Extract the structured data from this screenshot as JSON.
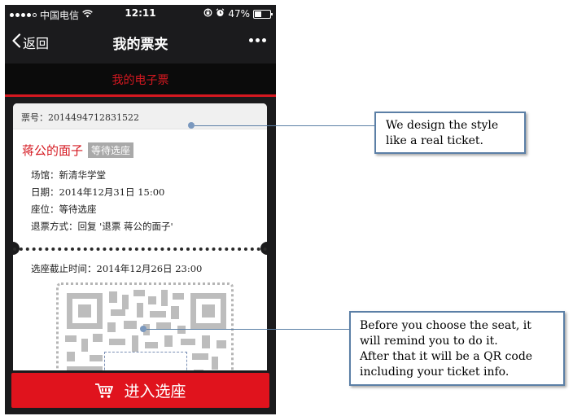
{
  "status_bar": {
    "carrier": "中国电信",
    "time": "12:11",
    "battery": "47%"
  },
  "nav": {
    "back_label": "返回",
    "title": "我的票夹"
  },
  "tab": {
    "label": "我的电子票"
  },
  "ticket": {
    "number_label": "票号：",
    "number": "2014494712831522",
    "title": "蒋公的面子",
    "badge": "等待选座",
    "info": [
      {
        "label": "场馆：",
        "value": "新清华学堂"
      },
      {
        "label": "日期：",
        "value": "2014年12月31日 15:00"
      },
      {
        "label": "座位：",
        "value": "等待选座"
      },
      {
        "label": "退票方式：",
        "value": "回复 '退票 蒋公的面子'"
      }
    ],
    "deadline_label": "选座截止时间：",
    "deadline": "2014年12月26日 23:00"
  },
  "action": {
    "select_seat_label": "进入选座"
  },
  "annotations": [
    {
      "lines": [
        "We design the style",
        "like a real ticket."
      ]
    },
    {
      "lines": [
        "Before you choose the seat, it",
        "will remind you to do it.",
        "After that it will be a QR code",
        "including your ticket info."
      ]
    }
  ],
  "colors": {
    "accent_red": "#d51820",
    "button_red": "#e0131d",
    "dark_bg": "#1b1b1d",
    "callout_border": "#5b7fa6"
  },
  "icons": [
    "signal-icon",
    "wifi-icon",
    "lock-rotation-icon",
    "alarm-icon",
    "battery-icon",
    "chevron-left-icon",
    "more-icon",
    "cart-icon",
    "qr-code-icon"
  ]
}
